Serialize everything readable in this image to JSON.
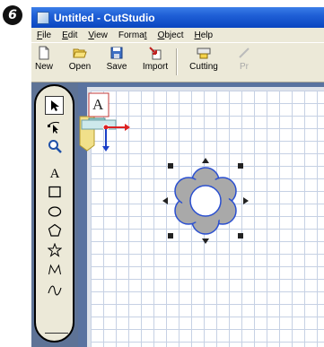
{
  "step": "6",
  "window": {
    "title": "Untitled - CutStudio"
  },
  "menu": [
    {
      "pre": "",
      "u": "F",
      "post": "ile"
    },
    {
      "pre": "",
      "u": "E",
      "post": "dit"
    },
    {
      "pre": "",
      "u": "V",
      "post": "iew"
    },
    {
      "pre": "Forma",
      "u": "t",
      "post": ""
    },
    {
      "pre": "",
      "u": "O",
      "post": "bject"
    },
    {
      "pre": "",
      "u": "H",
      "post": "elp"
    }
  ],
  "toolbar": {
    "new": "New",
    "open": "Open",
    "save": "Save",
    "import": "Import",
    "cutting": "Cutting",
    "preview": "Pr"
  },
  "icons": [
    "select-arrow-icon",
    "node-edit-icon",
    "magnifier-icon",
    "text-tool-icon",
    "rectangle-tool-icon",
    "ellipse-tool-icon",
    "polygon-tool-icon",
    "star-tool-icon",
    "polyline-tool-icon",
    "curve-tool-icon"
  ],
  "canvas": {
    "text_object": "A"
  }
}
